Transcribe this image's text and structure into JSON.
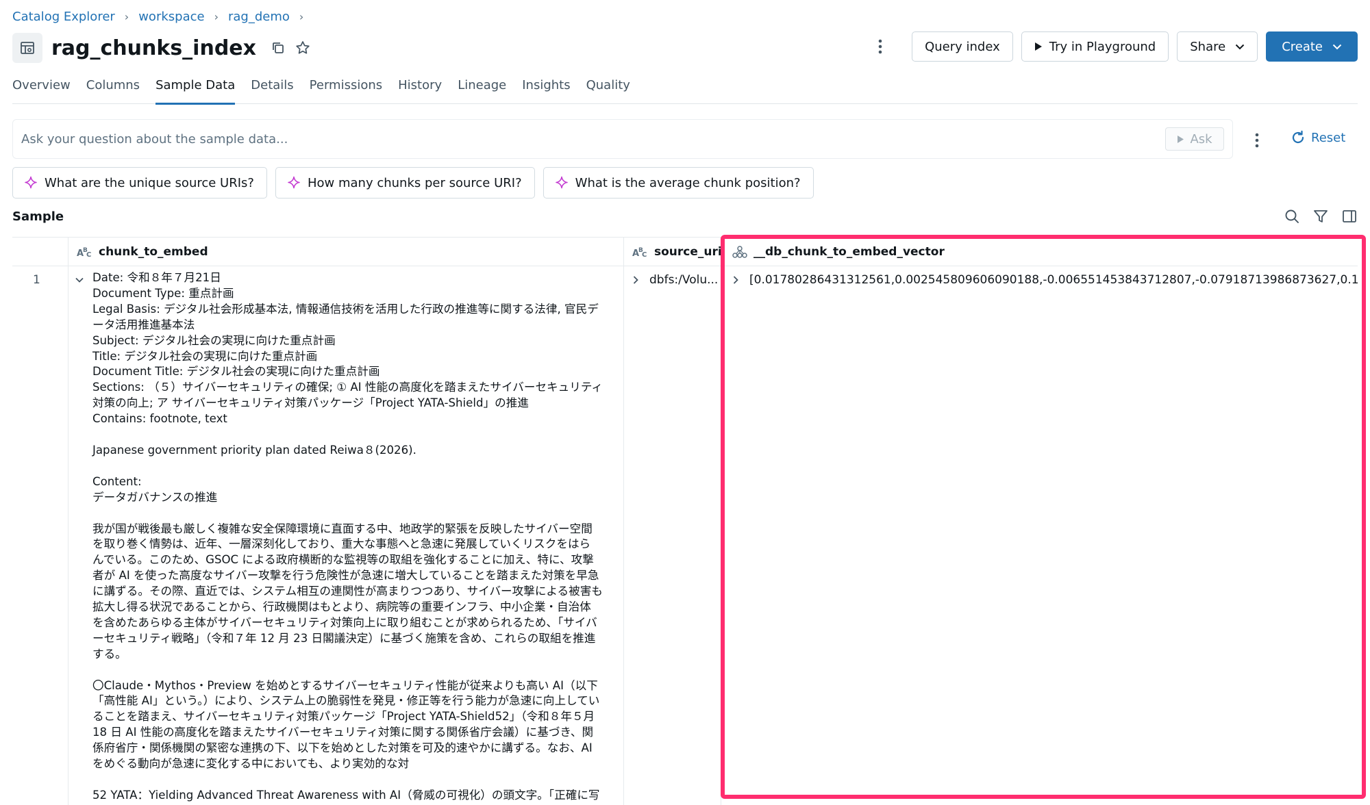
{
  "breadcrumb": [
    "Catalog Explorer",
    "workspace",
    "rag_demo"
  ],
  "title": "rag_chunks_index",
  "header_buttons": {
    "query_index": "Query index",
    "try_playground": "Try in Playground",
    "share": "Share",
    "create": "Create"
  },
  "tabs": [
    {
      "label": "Overview"
    },
    {
      "label": "Columns"
    },
    {
      "label": "Sample Data",
      "active": true
    },
    {
      "label": "Details"
    },
    {
      "label": "Permissions"
    },
    {
      "label": "History"
    },
    {
      "label": "Lineage"
    },
    {
      "label": "Insights"
    },
    {
      "label": "Quality"
    }
  ],
  "ask": {
    "placeholder": "Ask your question about the sample data...",
    "button": "Ask",
    "reset": "Reset"
  },
  "suggestions": [
    "What are the unique source URIs?",
    "How many chunks per source URI?",
    "What is the average chunk position?"
  ],
  "sample_label": "Sample",
  "columns": [
    {
      "name": "chunk_to_embed",
      "type_icon": "string-type-icon"
    },
    {
      "name": "source_uri",
      "type_icon": "string-type-icon"
    },
    {
      "name": "__db_chunk_to_embed_vector",
      "type_icon": "vector-type-icon"
    }
  ],
  "rows": [
    {
      "index": "1",
      "chunk_to_embed": "Date: 令和８年７月21日\nDocument Type: 重点計画\nLegal Basis: デジタル社会形成基本法, 情報通信技術を活用した行政の推進等に関する法律, 官民デ\nータ活用推進基本法\nSubject: デジタル社会の実現に向けた重点計画\nTitle: デジタル社会の実現に向けた重点計画\nDocument Title: デジタル社会の実現に向けた重点計画\nSections: （５）サイバーセキュリティの確保; ① AI 性能の高度化を踏まえたサイバーセキュリティ\n対策の向上; ア サイバーセキュリティ対策パッケージ「Project YATA-Shield」の推進\nContains: footnote, text\n\nJapanese government priority plan dated Reiwa８(2026).\n\nContent:\nデータガバナンスの推進\n\n我が国が戦後最も厳しく複雑な安全保障環境に直面する中、地政学的緊張を反映したサイバー空間\nを取り巻く情勢は、近年、一層深刻化しており、重大な事態へと急速に発展していくリスクをはら\nんでいる。このため、GSOC による政府横断的な監視等の取組を強化することに加え、特に、攻撃\n者が AI を使った高度なサイバー攻撃を行う危険性が急速に増大していることを踏まえた対策を早急\nに講ずる。その際、直近では、システム相互の連関性が高まりつつあり、サイバー攻撃による被害も\n拡大し得る状況であることから、行政機関はもとより、病院等の重要インフラ、中小企業・自治体\nを含めたあらゆる主体がサイバーセキュリティ対策向上に取り組むことが求められるため、「サイバ\nーセキュリティ戦略」（令和７年 12 月 23 日閣議決定）に基づく施策を含め、これらの取組を推進\nする。\n\n〇Claude・Mythos・Preview を始めとするサイバーセキュリティ性能が従来よりも高い AI（以下\n「高性能 AI」という。）により、システム上の脆弱性を発見・修正等を行う能力が急速に向上してい\nることを踏まえ、サイバーセキュリティ対策パッケージ「Project YATA-Shield52」（令和８年５月\n18 日 AI 性能の高度化を踏まえたサイバーセキュリティ対策に関する関係省庁会議）に基づき、関\n係府省庁・関係機関の緊密な連携の下、以下を始めとした対策を可及的速やかに講ずる。なお、AI\nをめぐる動向が急速に変化する中においても、より実効的な対\n\n52 YATA：Yielding Advanced Threat Awareness with AI（脅威の可視化）の頭文字。「正確に写",
      "source_uri": "dbfs:/Volu...",
      "vector": "[0.01780286431312561,0.002545809606090188,-0.006551453843712807,-0.07918713986873627,0.1"
    }
  ],
  "colors": {
    "accent": "#2272b4",
    "highlight_border": "#ff2d6f",
    "ai_sparkle": "#c33bd1"
  }
}
